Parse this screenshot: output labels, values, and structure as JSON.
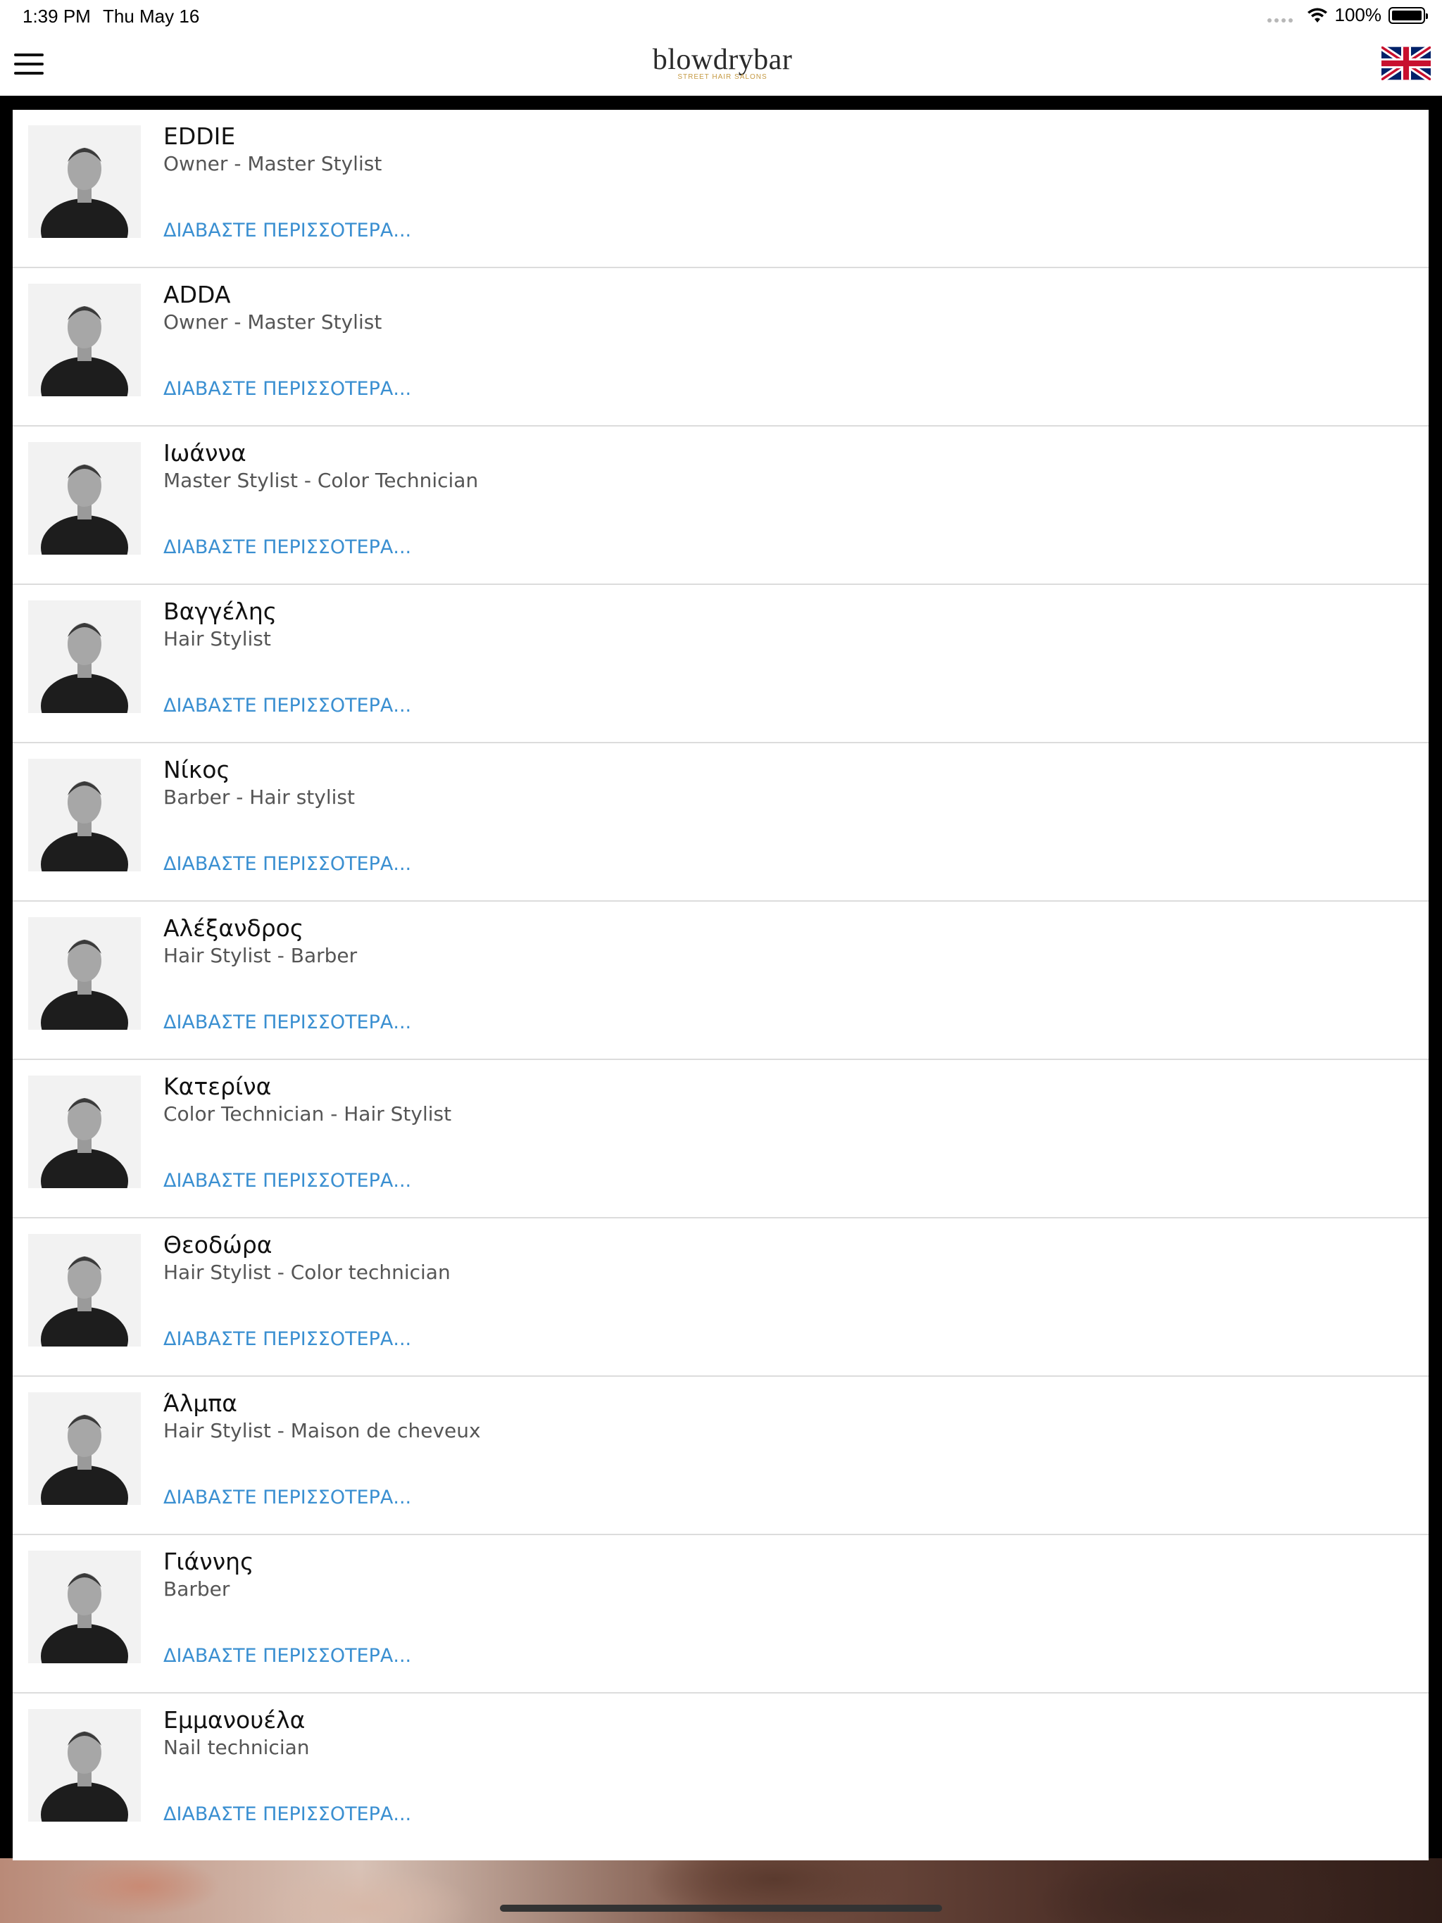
{
  "status_bar": {
    "time": "1:39 PM",
    "date": "Thu May 16",
    "battery": "100%",
    "icons": [
      "signal-dots-icon",
      "wifi-icon",
      "battery-icon"
    ]
  },
  "header": {
    "logo_text": "blowdrybar",
    "logo_subtitle": "STREET HAIR SALONS",
    "menu_icon": "hamburger-menu-icon",
    "language_icon": "uk-flag-icon"
  },
  "colors": {
    "link": "#3a8fd1",
    "logo_accent": "#c59a44",
    "divider": "#dcdcdc",
    "frame": "#000000"
  },
  "staff": [
    {
      "name": "EDDIE",
      "role": "Owner - Master Stylist",
      "link": "ΔΙΑΒΑΣΤΕ ΠΕΡΙΣΣΟΤΕΡΑ..."
    },
    {
      "name": "ADDA",
      "role": "Owner - Master Stylist",
      "link": "ΔΙΑΒΑΣΤΕ ΠΕΡΙΣΣΟΤΕΡΑ..."
    },
    {
      "name": "Ιωάννα",
      "role": "Master Stylist - Color Technician",
      "link": "ΔΙΑΒΑΣΤΕ ΠΕΡΙΣΣΟΤΕΡΑ..."
    },
    {
      "name": "Βαγγέλης",
      "role": "Hair Stylist",
      "link": "ΔΙΑΒΑΣΤΕ ΠΕΡΙΣΣΟΤΕΡΑ..."
    },
    {
      "name": "Νίκος",
      "role": "Barber - Hair stylist",
      "link": "ΔΙΑΒΑΣΤΕ ΠΕΡΙΣΣΟΤΕΡΑ..."
    },
    {
      "name": "Αλέξανδρος",
      "role": "Hair Stylist - Barber",
      "link": "ΔΙΑΒΑΣΤΕ ΠΕΡΙΣΣΟΤΕΡΑ..."
    },
    {
      "name": "Κατερίνα",
      "role": "Color Technician - Hair Stylist",
      "link": "ΔΙΑΒΑΣΤΕ ΠΕΡΙΣΣΟΤΕΡΑ..."
    },
    {
      "name": "Θεοδώρα",
      "role": "Hair Stylist - Color technician",
      "link": "ΔΙΑΒΑΣΤΕ ΠΕΡΙΣΣΟΤΕΡΑ..."
    },
    {
      "name": "Άλμπα",
      "role": "Hair Stylist - Maison de cheveux",
      "link": "ΔΙΑΒΑΣΤΕ ΠΕΡΙΣΣΟΤΕΡΑ..."
    },
    {
      "name": "Γιάννης",
      "role": "Barber",
      "link": "ΔΙΑΒΑΣΤΕ ΠΕΡΙΣΣΟΤΕΡΑ..."
    },
    {
      "name": "Εμμανουέλα",
      "role": "Nail technician",
      "link": "ΔΙΑΒΑΣΤΕ ΠΕΡΙΣΣΟΤΕΡΑ..."
    }
  ]
}
